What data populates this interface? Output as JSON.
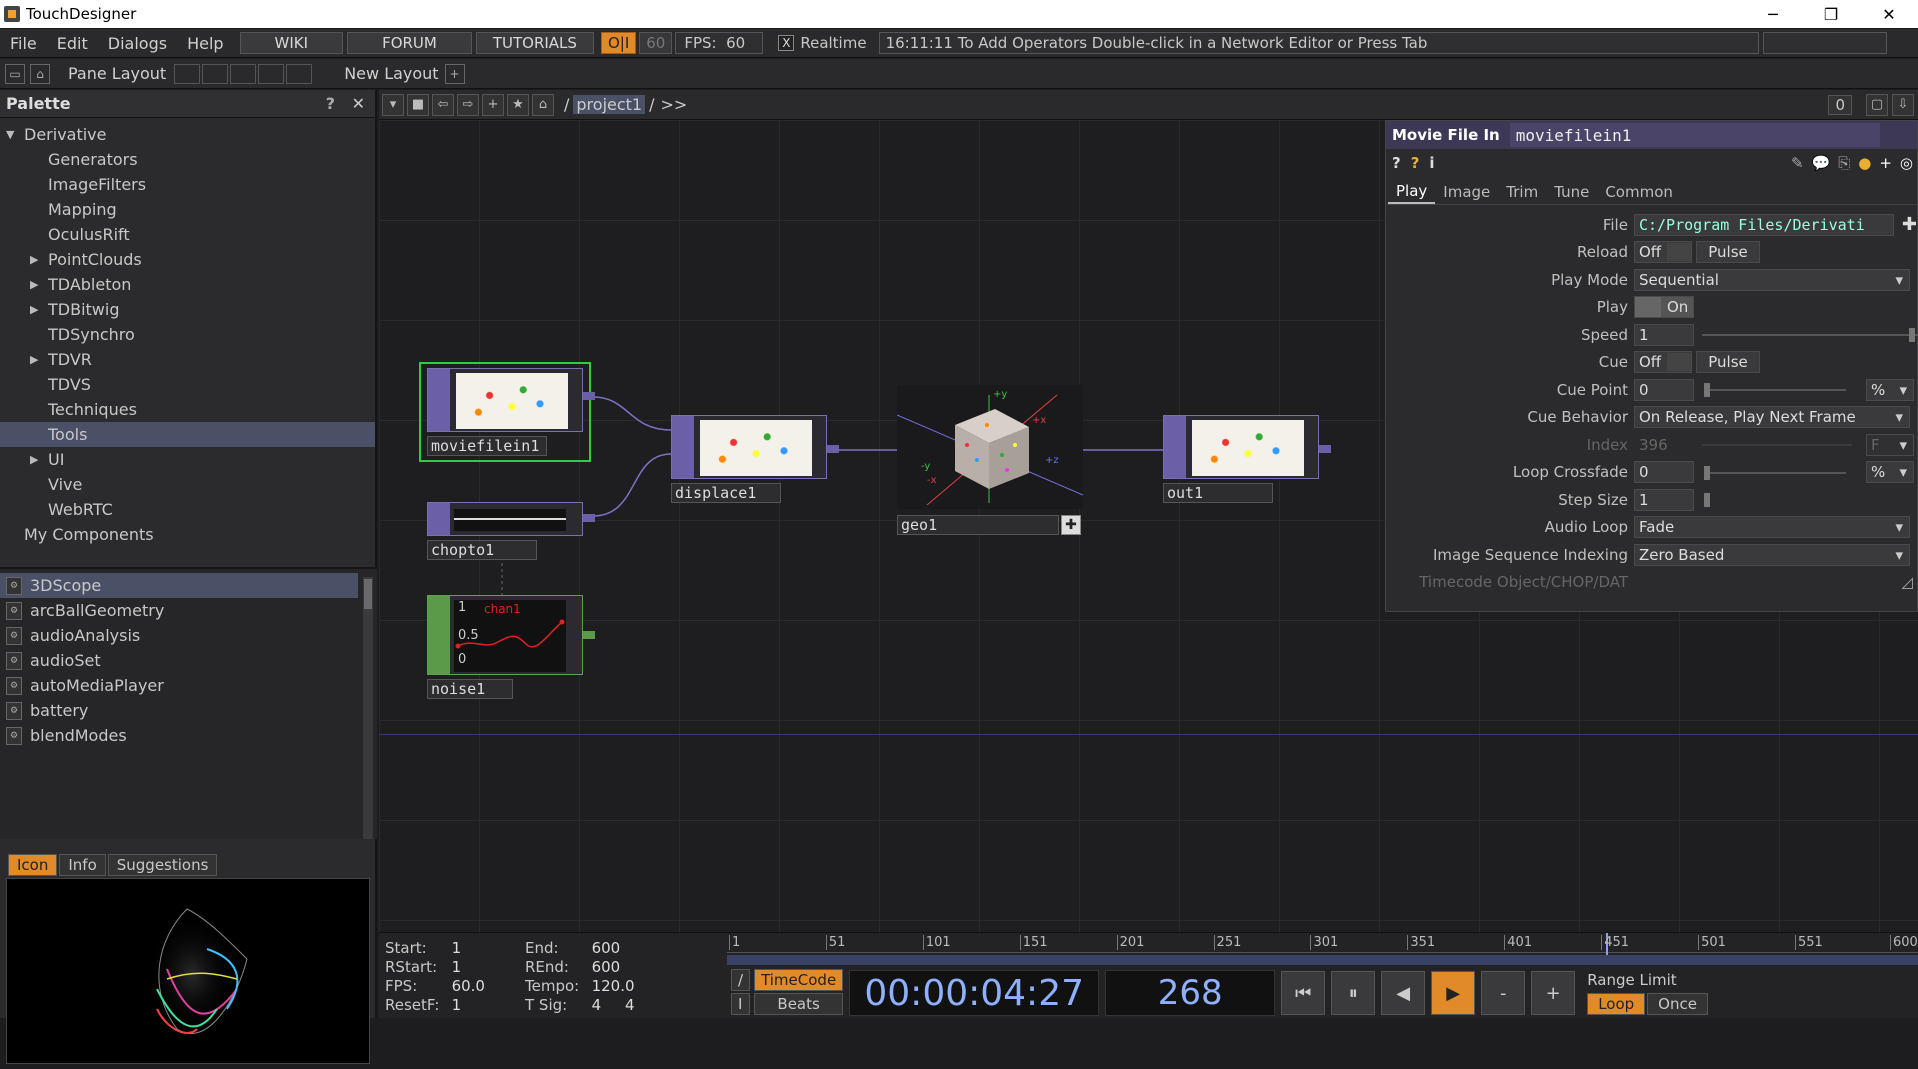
{
  "app": {
    "title": "TouchDesigner"
  },
  "window_controls": {
    "minimize": "─",
    "maximize": "❐",
    "close": "✕"
  },
  "menu": {
    "file": "File",
    "edit": "Edit",
    "dialogs": "Dialogs",
    "help": "Help",
    "wiki": "WIKI",
    "forum": "FORUM",
    "tutorials": "TUTORIALS",
    "oi": "O|I",
    "fps_cap": "60",
    "fps_label": "FPS:",
    "fps_value": "60",
    "realtime_check": "X",
    "realtime": "Realtime",
    "message": "16:11:11 To Add Operators Double-click in a Network Editor or Press Tab"
  },
  "toolbar": {
    "pane_layout": "Pane Layout",
    "new_layout": "New Layout",
    "add": "+"
  },
  "palette": {
    "title": "Palette",
    "help": "?",
    "close": "✕",
    "tree": [
      {
        "label": "Derivative",
        "arrow": "▼"
      },
      {
        "label": "Generators"
      },
      {
        "label": "ImageFilters"
      },
      {
        "label": "Mapping"
      },
      {
        "label": "OculusRift"
      },
      {
        "label": "PointClouds",
        "arrow": "▶"
      },
      {
        "label": "TDAbleton",
        "arrow": "▶"
      },
      {
        "label": "TDBitwig",
        "arrow": "▶"
      },
      {
        "label": "TDSynchro"
      },
      {
        "label": "TDVR",
        "arrow": "▶"
      },
      {
        "label": "TDVS"
      },
      {
        "label": "Techniques"
      },
      {
        "label": "Tools"
      },
      {
        "label": "UI",
        "arrow": "▶"
      },
      {
        "label": "Vive"
      },
      {
        "label": "WebRTC"
      },
      {
        "label": "My Components"
      }
    ],
    "components": [
      "3DScope",
      "arcBallGeometry",
      "audioAnalysis",
      "audioSet",
      "autoMediaPlayer",
      "battery",
      "blendModes"
    ],
    "preview_tabs": {
      "icon": "Icon",
      "info": "Info",
      "suggestions": "Suggestions"
    }
  },
  "network": {
    "path_root": "/",
    "path_project": "project1",
    "path_sep": "/",
    "path_more": ">>",
    "right_count": "0",
    "nodes": {
      "moviefilein1": "moviefilein1",
      "displace1": "displace1",
      "geo1": "geo1",
      "out1": "out1",
      "chopto1": "chopto1",
      "noise1": "noise1"
    },
    "noise_graph": {
      "y_top": "1",
      "y_mid": "0.5",
      "y_bot": "0",
      "channel": "chan1"
    },
    "geo_axes": {
      "y": "+y",
      "x": "+x",
      "z": "+z",
      "nx": "-x",
      "ny": "-y"
    }
  },
  "params": {
    "op_type": "Movie File In",
    "op_name": "moviefilein1",
    "tabs": [
      "Play",
      "Image",
      "Trim",
      "Tune",
      "Common"
    ],
    "rows": {
      "file": {
        "label": "File",
        "value": "C:/Program Files/Derivati"
      },
      "reload": {
        "label": "Reload",
        "off": "Off",
        "pulse": "Pulse"
      },
      "play_mode": {
        "label": "Play Mode",
        "value": "Sequential"
      },
      "play": {
        "label": "Play",
        "value": "On"
      },
      "speed": {
        "label": "Speed",
        "value": "1"
      },
      "cue": {
        "label": "Cue",
        "off": "Off",
        "pulse": "Pulse"
      },
      "cue_point": {
        "label": "Cue Point",
        "value": "0",
        "unit": "%"
      },
      "cue_behavior": {
        "label": "Cue Behavior",
        "value": "On Release, Play Next Frame"
      },
      "index": {
        "label": "Index",
        "value": "396",
        "unit": "F"
      },
      "loop_crossfade": {
        "label": "Loop Crossfade",
        "value": "0",
        "unit": "%"
      },
      "step_size": {
        "label": "Step Size",
        "value": "1"
      },
      "audio_loop": {
        "label": "Audio Loop",
        "value": "Fade"
      },
      "image_seq": {
        "label": "Image Sequence Indexing",
        "value": "Zero Based"
      },
      "timecode": {
        "label": "Timecode Object/CHOP/DAT"
      }
    }
  },
  "timeline": {
    "start_k": "Start:",
    "start_v": "1",
    "end_k": "End:",
    "end_v": "600",
    "rstart_k": "RStart:",
    "rstart_v": "1",
    "rend_k": "REnd:",
    "rend_v": "600",
    "fps_k": "FPS:",
    "fps_v": "60.0",
    "tempo_k": "Tempo:",
    "tempo_v": "120.0",
    "resetf_k": "ResetF:",
    "resetf_v": "1",
    "tsig_k": "T Sig:",
    "tsig_v1": "4",
    "tsig_v2": "4",
    "ruler": [
      "1",
      "51",
      "101",
      "151",
      "201",
      "251",
      "301",
      "351",
      "401",
      "451",
      "501",
      "551",
      "600"
    ],
    "timecode_btn": "TimeCode",
    "beats_btn": "Beats",
    "slash_btn": "/",
    "bar_btn": "I",
    "timecode": "00:00:04:27",
    "frame": "268",
    "range_limit": "Range Limit",
    "loop": "Loop",
    "once": "Once",
    "minus": "-",
    "plus": "+"
  }
}
